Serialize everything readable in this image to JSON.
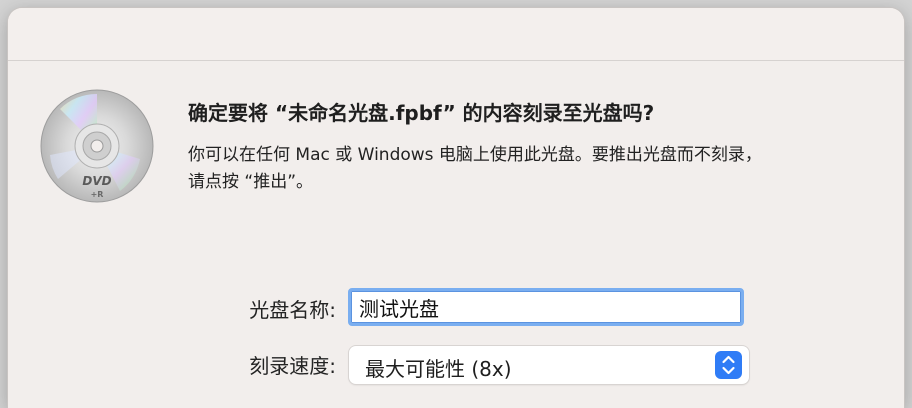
{
  "dialog": {
    "heading": "确定要将 “未命名光盘.fpbf” 的内容刻录至光盘吗?",
    "body_line1": "你可以在任何 Mac 或 Windows 电脑上使用此光盘。要推出光盘而不刻录，",
    "body_line2": "请点按 “推出”。",
    "disc_icon": {
      "name": "dvd-r-disc-icon",
      "label_main": "DVD",
      "label_sub": "+R"
    }
  },
  "form": {
    "name_label": "光盘名称:",
    "name_value": "测试光盘",
    "speed_label": "刻录速度:",
    "speed_value": "最大可能性 (8x)"
  },
  "colors": {
    "focus_ring": "#7aaef0",
    "stepper": "#2f7cf6",
    "dialog_bg": "#f2eeec"
  }
}
